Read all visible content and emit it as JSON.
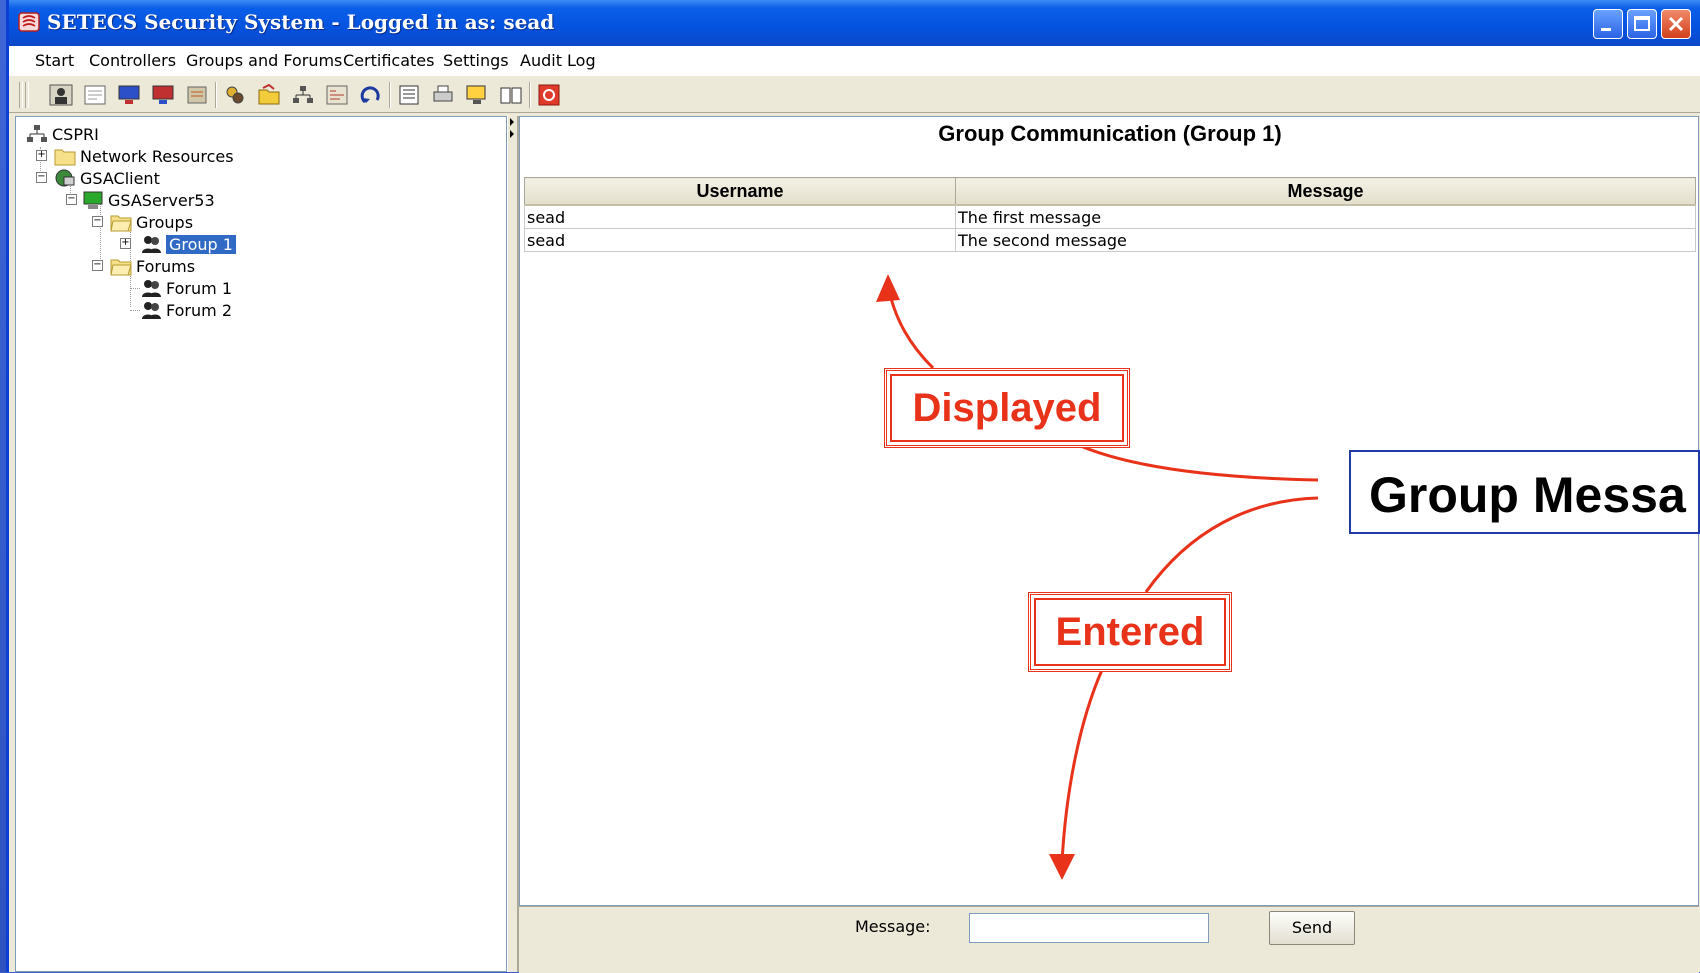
{
  "window": {
    "title": "SETECS Security System - Logged in as: sead",
    "controls": [
      "minimize",
      "maximize",
      "close"
    ]
  },
  "menu": [
    "Start",
    "Controllers",
    "Groups and Forums",
    "Certificates",
    "Settings",
    "Audit Log"
  ],
  "toolbar": {
    "icons": [
      "user-icon",
      "certificate-icon",
      "computer-icon",
      "computer-red-icon",
      "database-icon",
      "users-gear-icon",
      "folder-open-icon",
      "network-icon",
      "report-icon",
      "refresh-icon",
      "list-icon",
      "print-icon",
      "monitor-icon",
      "book-icon",
      "power-icon"
    ]
  },
  "tree": {
    "root": "CSPRI",
    "network_resources": "Network Resources",
    "client": "GSAClient",
    "server": "GSAServer53",
    "groups": "Groups",
    "group1": "Group 1",
    "forums": "Forums",
    "forum1": "Forum 1",
    "forum2": "Forum 2"
  },
  "panel": {
    "title": "Group Communication (Group 1)",
    "columns": [
      "Username",
      "Message"
    ],
    "rows": [
      [
        "sead",
        "The first message"
      ],
      [
        "sead",
        "The second message"
      ]
    ]
  },
  "composer": {
    "label": "Message:",
    "value": "",
    "send_label": "Send"
  },
  "annotations": {
    "displayed": "Displayed",
    "entered": "Entered",
    "group_box": "Group Messa",
    "arrow_color": "#e8331a"
  }
}
